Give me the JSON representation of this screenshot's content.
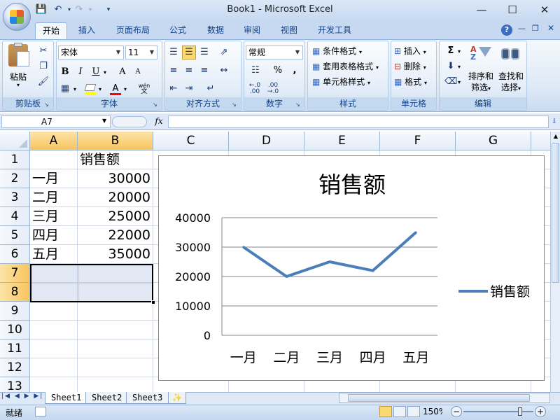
{
  "window": {
    "title": "Book1 - Microsoft Excel",
    "qat": [
      "save-icon",
      "undo-icon",
      "redo-icon",
      "customize-icon"
    ]
  },
  "tabs": [
    "开始",
    "插入",
    "页面布局",
    "公式",
    "数据",
    "审阅",
    "视图",
    "开发工具"
  ],
  "ribbon": {
    "clipboard": {
      "paste": "粘贴",
      "label": "剪贴板"
    },
    "font": {
      "name": "宋体",
      "size": "11",
      "bold": "B",
      "italic": "I",
      "underline": "U",
      "grow": "A",
      "shrink": "A",
      "phonetic": "wén",
      "label": "字体"
    },
    "alignment": {
      "label": "对齐方式"
    },
    "number": {
      "format": "常规",
      "percent": "%",
      "comma": ",",
      "label": "数字"
    },
    "styles": {
      "conditional": "条件格式",
      "table": "套用表格格式",
      "cell": "单元格样式",
      "label": "样式"
    },
    "cells": {
      "insert": "插入",
      "delete": "删除",
      "format": "格式",
      "label": "单元格"
    },
    "editing": {
      "sort": "排序和\n筛选",
      "sort1": "排序和",
      "sort2": "筛选",
      "find1": "查找和",
      "find2": "选择",
      "label": "编辑"
    }
  },
  "formula_bar": {
    "name_box": "A7",
    "fx": "fx",
    "formula": ""
  },
  "columns": [
    "A",
    "B",
    "C",
    "D",
    "E",
    "F",
    "G"
  ],
  "rows": [
    "1",
    "2",
    "3",
    "4",
    "5",
    "6",
    "7",
    "8",
    "9",
    "10",
    "11",
    "12",
    "13"
  ],
  "cells": {
    "B1": "销售额",
    "A2": "一月",
    "B2": "30000",
    "A3": "二月",
    "B3": "20000",
    "A4": "三月",
    "B4": "25000",
    "A5": "四月",
    "B5": "22000",
    "A6": "五月",
    "B6": "35000"
  },
  "selection": "A7:B8",
  "chart_data": {
    "type": "line",
    "title": "销售额",
    "categories": [
      "一月",
      "二月",
      "三月",
      "四月",
      "五月"
    ],
    "series": [
      {
        "name": "销售额",
        "values": [
          30000,
          20000,
          25000,
          22000,
          35000
        ],
        "color": "#4a7ebb"
      }
    ],
    "ylim": [
      0,
      40000
    ],
    "yticks": [
      "0",
      "10000",
      "20000",
      "30000",
      "40000"
    ],
    "grid": true,
    "legend": "right"
  },
  "sheets": [
    "Sheet1",
    "Sheet2",
    "Sheet3"
  ],
  "status": {
    "ready": "就绪",
    "zoom": "150%"
  }
}
